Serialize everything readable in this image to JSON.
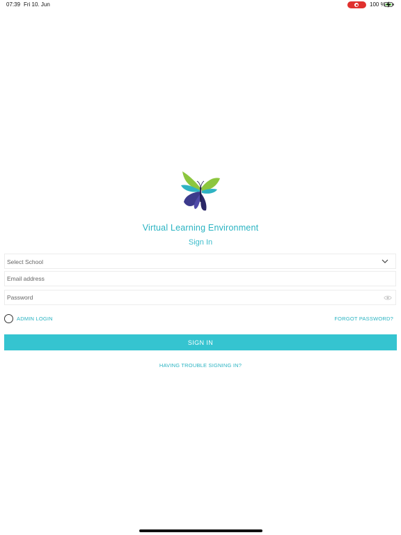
{
  "status_bar": {
    "time": "07:39",
    "date": "Fri 10. Jun",
    "battery": "100 %",
    "recording_color": "#e0312e",
    "battery_color": "#5ec34a"
  },
  "brand": {
    "logo_icon": "butterfly-logo",
    "title": "Virtual Learning Environment",
    "accent_color": "#29b3c2",
    "button_color": "#35c4d0"
  },
  "form": {
    "heading": "Sign In",
    "school_select": {
      "value": "Select School",
      "icon": "chevron-down-icon"
    },
    "email": {
      "placeholder": "Email address",
      "value": ""
    },
    "password": {
      "placeholder": "Password",
      "value": "",
      "icon": "eye-icon"
    },
    "admin_login_label": "ADMIN LOGIN",
    "admin_login_checked": false,
    "forgot_password": "FORGOT PASSWORD?",
    "submit_label": "SIGN IN",
    "trouble_link": "HAVING TROUBLE SIGNING IN?"
  }
}
